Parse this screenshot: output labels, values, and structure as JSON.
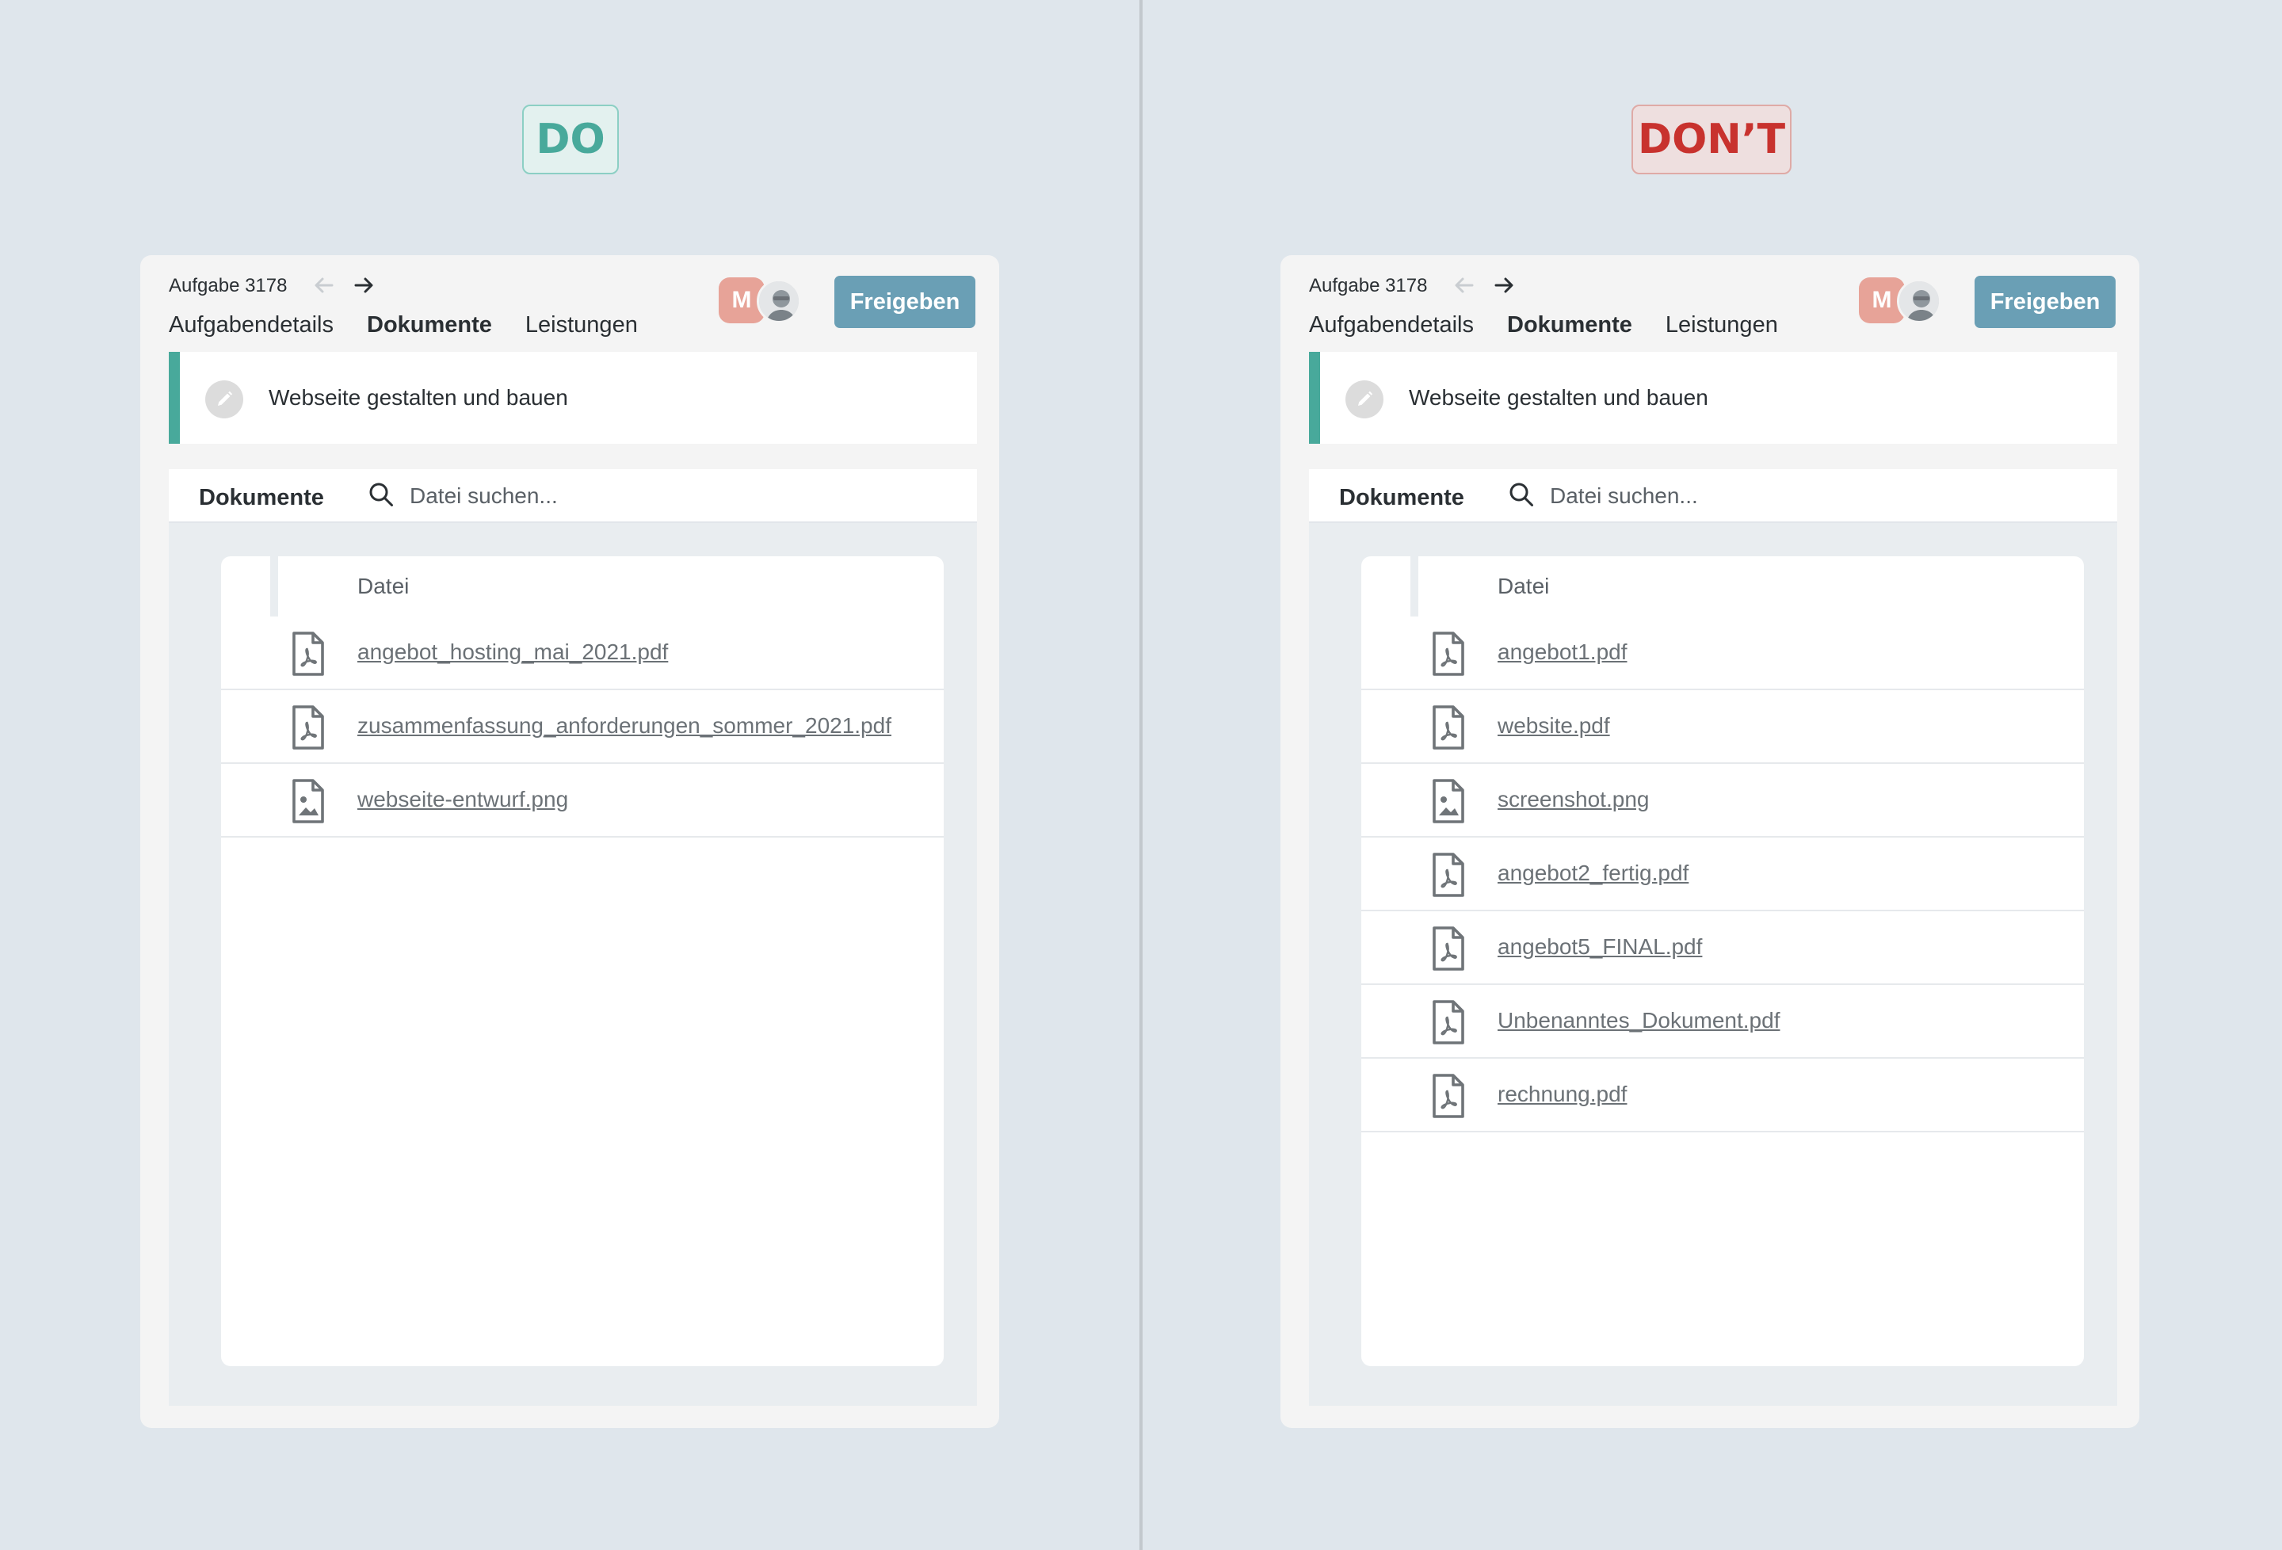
{
  "panels": [
    {
      "verdict": "DO",
      "task_id": "Aufgabe 3178",
      "tabs": [
        "Aufgabendetails",
        "Dokumente",
        "Leistungen"
      ],
      "active_tab": "Dokumente",
      "avatar_initial": "M",
      "share_label": "Freigeben",
      "task_title": "Webseite gestalten und bauen",
      "docs_label": "Dokumente",
      "search_placeholder": "Datei suchen...",
      "column_header": "Datei",
      "files": [
        {
          "name": "angebot_hosting_mai_2021.pdf",
          "icon": "pdf-file-icon"
        },
        {
          "name": "zusammenfassung_anforderungen_sommer_2021.pdf",
          "icon": "pdf-file-icon"
        },
        {
          "name": "webseite-entwurf.png",
          "icon": "image-file-icon"
        }
      ]
    },
    {
      "verdict": "DON’T",
      "task_id": "Aufgabe 3178",
      "tabs": [
        "Aufgabendetails",
        "Dokumente",
        "Leistungen"
      ],
      "active_tab": "Dokumente",
      "avatar_initial": "M",
      "share_label": "Freigeben",
      "task_title": "Webseite gestalten und bauen",
      "docs_label": "Dokumente",
      "search_placeholder": "Datei suchen...",
      "column_header": "Datei",
      "files": [
        {
          "name": "angebot1.pdf",
          "icon": "pdf-file-icon"
        },
        {
          "name": "website.pdf",
          "icon": "pdf-file-icon"
        },
        {
          "name": "screenshot.png",
          "icon": "image-file-icon"
        },
        {
          "name": "angebot2_fertig.pdf",
          "icon": "pdf-file-icon"
        },
        {
          "name": "angebot5_FINAL.pdf",
          "icon": "pdf-file-icon"
        },
        {
          "name": "Unbenanntes_Dokument.pdf",
          "icon": "pdf-file-icon"
        },
        {
          "name": "rechnung.pdf",
          "icon": "pdf-file-icon"
        }
      ]
    }
  ],
  "colors": {
    "background": "#dfe6ec",
    "do_accent": "#48a99b",
    "dont_accent": "#c8322e",
    "share_button": "#6a9fb5",
    "avatar": "#e7a398",
    "title_bar_accent": "#48a99b"
  }
}
